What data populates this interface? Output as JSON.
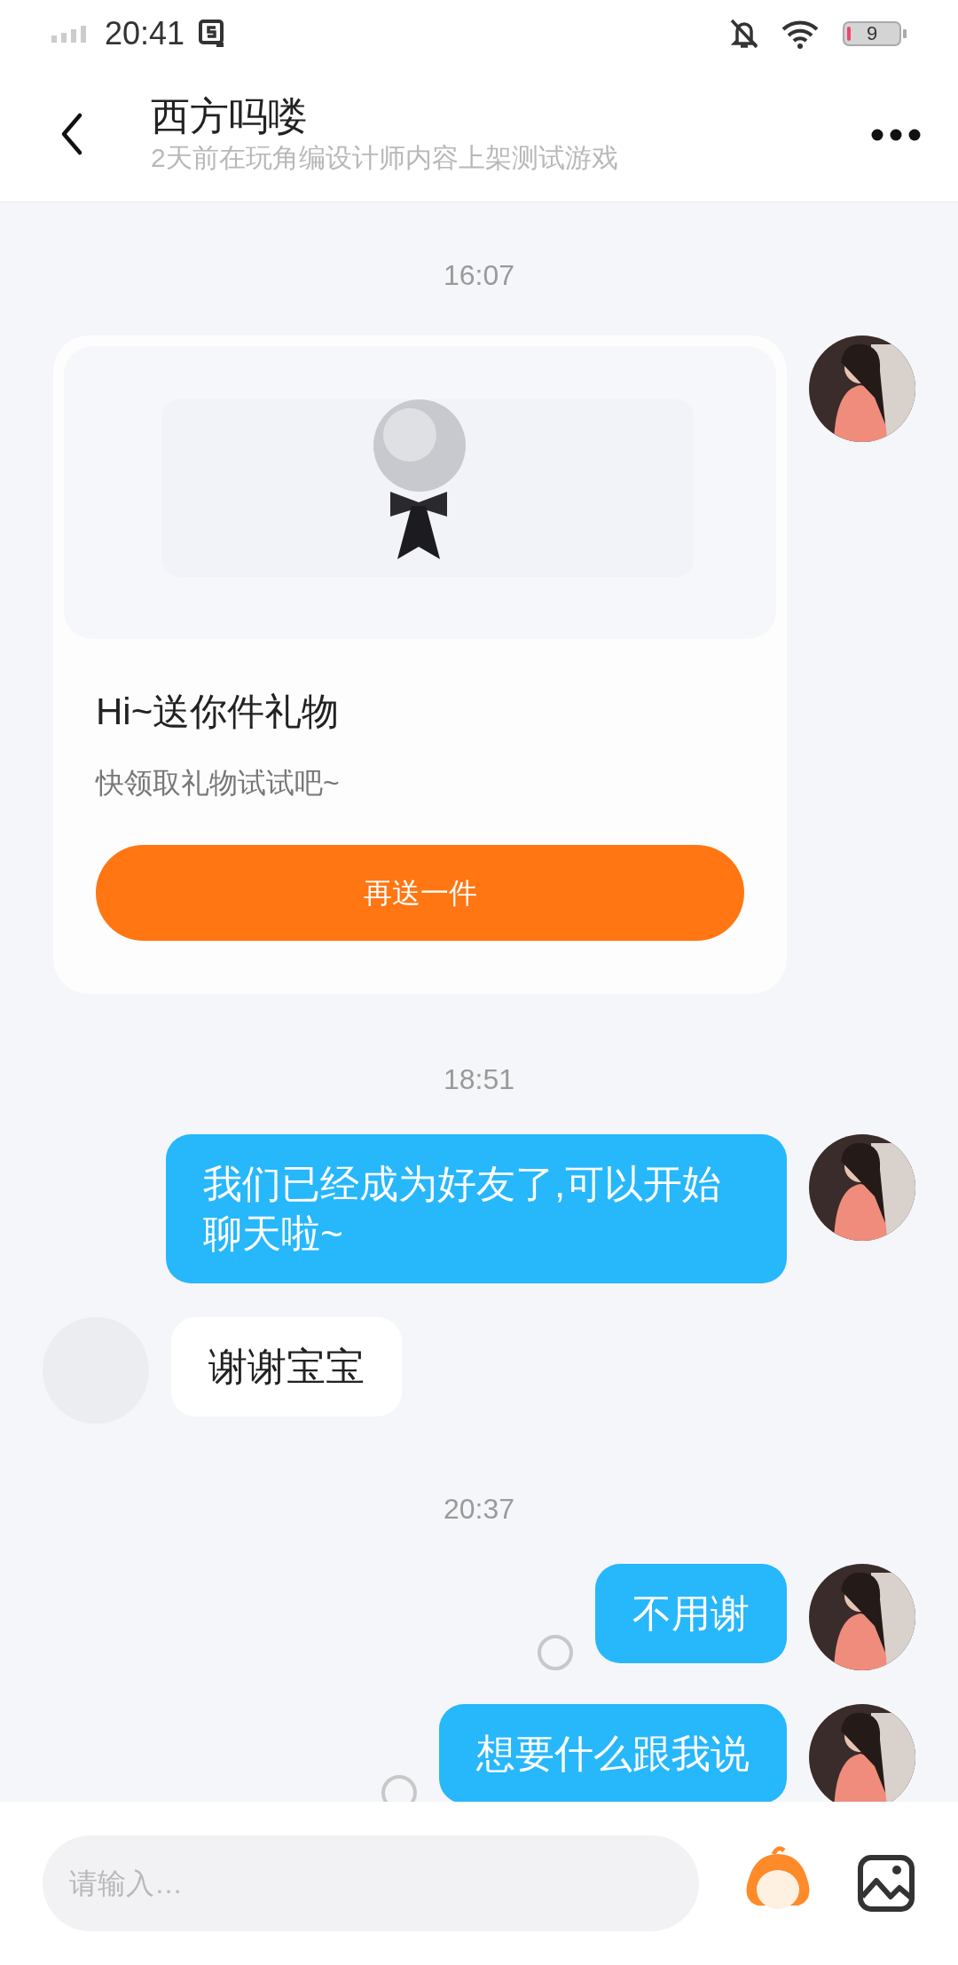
{
  "status_bar": {
    "time": "20:41",
    "battery_text": "9"
  },
  "header": {
    "title": "西方吗喽",
    "subtitle": "2天前在玩角编设计师内容上架测试游戏"
  },
  "messages": [
    {
      "kind": "time",
      "text": "16:07"
    },
    {
      "kind": "gift_card",
      "title": "Hi~送你件礼物",
      "subtitle": "快领取礼物试试吧~",
      "button": "再送一件"
    },
    {
      "kind": "time",
      "text": "18:51"
    },
    {
      "kind": "message",
      "outgoing": true,
      "text": "我们已经成为好友了,可以开始聊天啦~",
      "pending": false
    },
    {
      "kind": "message",
      "outgoing": false,
      "text": "谢谢宝宝"
    },
    {
      "kind": "time",
      "text": "20:37"
    },
    {
      "kind": "message",
      "outgoing": true,
      "text": "不用谢",
      "pending": true
    },
    {
      "kind": "message",
      "outgoing": true,
      "text": "想要什么跟我说",
      "pending": true
    }
  ],
  "composer": {
    "placeholder": "请输入…"
  }
}
